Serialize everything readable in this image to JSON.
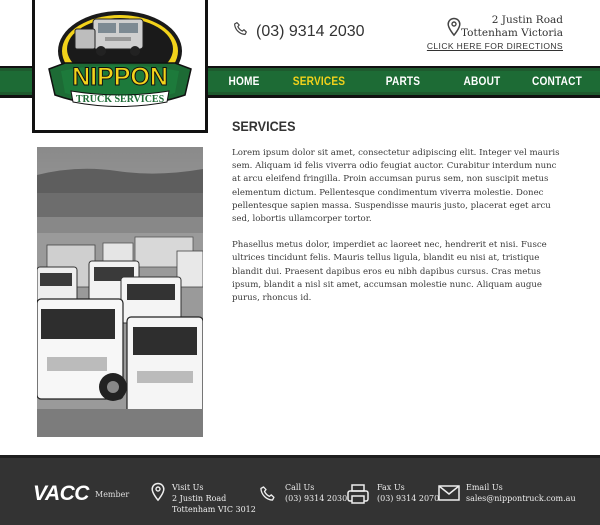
{
  "header": {
    "logo_text": "NIPPON TRUCK SERVICES",
    "phone": "(03) 9314 2030",
    "address_line1": "2 Justin Road",
    "address_line2": "Tottenham Victoria",
    "directions_link": "CLICK HERE FOR DIRECTIONS"
  },
  "nav": {
    "items": [
      {
        "label": "HOME",
        "active": false
      },
      {
        "label": "SERVICES",
        "active": true
      },
      {
        "label": "PARTS",
        "active": false
      },
      {
        "label": "ABOUT",
        "active": false
      },
      {
        "label": "CONTACT",
        "active": false
      }
    ]
  },
  "main": {
    "title": "SERVICES",
    "paragraphs": [
      "Lorem ipsum dolor sit amet, consectetur adipiscing elit. Integer vel mauris sem. Aliquam id felis viverra odio feugiat auctor. Curabitur interdum nunc at arcu eleifend fringilla. Proin accumsan purus sem, non suscipit metus elementum dictum. Pellentesque condimentum viverra molestie. Donec pellentesque sapien massa. Suspendisse mauris justo, placerat eget arcu sed, lobortis ullamcorper tortor.",
      "Phasellus metus dolor, imperdiet ac laoreet nec, hendrerit et nisi. Fusce ultrices tincidunt felis. Mauris tellus ligula, blandit eu nisi at, tristique blandit dui. Praesent dapibus eros eu nibh dapibus cursus. Cras metus ipsum, blandit a nisl sit amet, accumsan molestie nunc. Aliquam augue purus, rhoncus id."
    ]
  },
  "footer": {
    "vacc": "VACC",
    "member": "Member",
    "visit_title": "Visit Us",
    "visit_line1": "2 Justin Road",
    "visit_line2": "Tottenham VIC 3012",
    "call_title": "Call Us",
    "call_value": "(03) 9314 2030",
    "fax_title": "Fax Us",
    "fax_value": "(03) 9314 2070",
    "email_title": "Email Us",
    "email_value": "sales@nippontruck.com.au"
  },
  "colors": {
    "nav_green": "#1d6b35",
    "active_yellow": "#f2d21b",
    "footer_bg": "#333333"
  },
  "icons": [
    "phone-icon",
    "location-pin-icon",
    "fax-icon",
    "envelope-icon"
  ]
}
